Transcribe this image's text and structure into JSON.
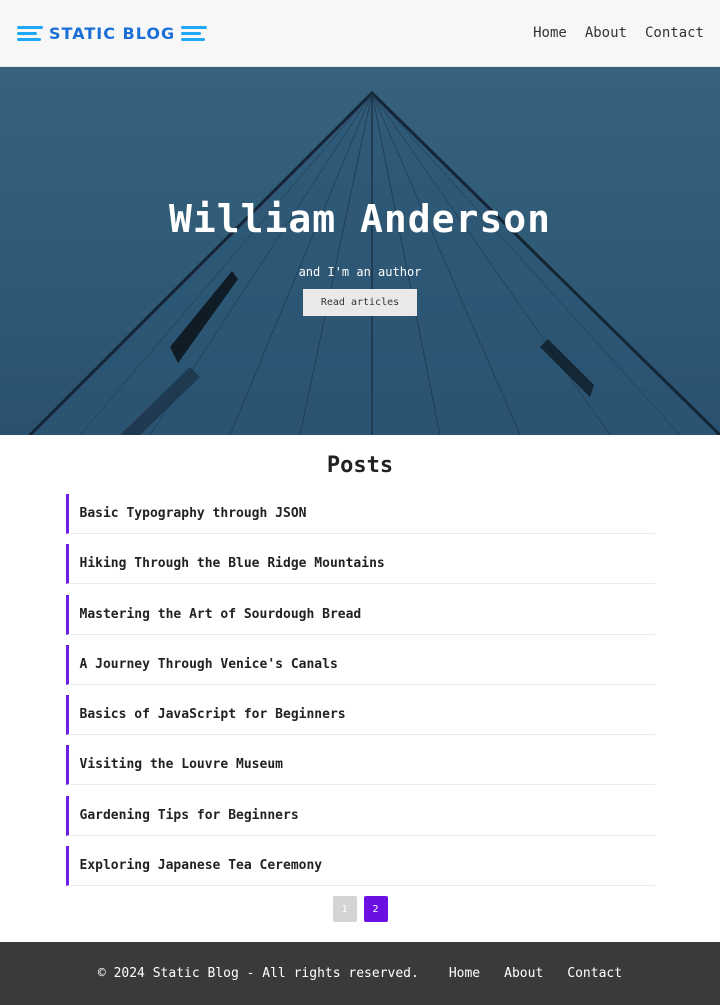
{
  "header": {
    "logo_text": "STATIC BLOG",
    "nav": [
      "Home",
      "About",
      "Contact"
    ]
  },
  "hero": {
    "title": "William Anderson",
    "subtitle": "and I'm an author",
    "button_label": "Read articles"
  },
  "posts": {
    "heading": "Posts",
    "items": [
      "Basic Typography through JSON",
      "Hiking Through the Blue Ridge Mountains",
      "Mastering the Art of Sourdough Bread",
      "A Journey Through Venice's Canals",
      "Basics of JavaScript for Beginners",
      "Visiting the Louvre Museum",
      "Gardening Tips for Beginners",
      "Exploring Japanese Tea Ceremony"
    ],
    "accent_color": "#6a1ee6"
  },
  "pagination": {
    "pages": [
      "1",
      "2"
    ],
    "current": "2"
  },
  "footer": {
    "copyright": "© 2024 Static Blog - All rights reserved.",
    "nav": [
      "Home",
      "About",
      "Contact"
    ]
  }
}
